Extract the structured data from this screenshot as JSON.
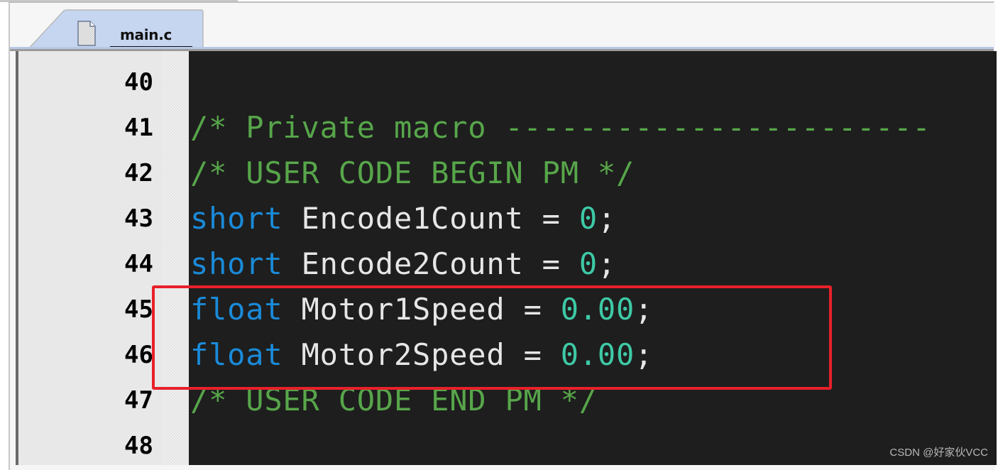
{
  "editor": {
    "tab": {
      "filename": "main.c",
      "icon": "document-icon"
    },
    "lines": [
      {
        "number": "40",
        "tokens": []
      },
      {
        "number": "41",
        "tokens": [
          {
            "type": "comment",
            "text": "/* Private macro -----------------------"
          }
        ]
      },
      {
        "number": "42",
        "tokens": [
          {
            "type": "comment",
            "text": "/* USER CODE BEGIN PM */"
          }
        ]
      },
      {
        "number": "43",
        "tokens": [
          {
            "type": "keyword",
            "text": "short"
          },
          {
            "type": "ident",
            "text": " Encode1Count "
          },
          {
            "type": "op",
            "text": "= "
          },
          {
            "type": "number",
            "text": "0"
          },
          {
            "type": "op",
            "text": ";"
          }
        ]
      },
      {
        "number": "44",
        "tokens": [
          {
            "type": "keyword",
            "text": "short"
          },
          {
            "type": "ident",
            "text": " Encode2Count "
          },
          {
            "type": "op",
            "text": "= "
          },
          {
            "type": "number",
            "text": "0"
          },
          {
            "type": "op",
            "text": ";"
          }
        ]
      },
      {
        "number": "45",
        "tokens": [
          {
            "type": "keyword",
            "text": "float"
          },
          {
            "type": "ident",
            "text": " Motor1Speed "
          },
          {
            "type": "op",
            "text": "= "
          },
          {
            "type": "number",
            "text": "0.00"
          },
          {
            "type": "op",
            "text": ";"
          }
        ]
      },
      {
        "number": "46",
        "tokens": [
          {
            "type": "keyword",
            "text": "float"
          },
          {
            "type": "ident",
            "text": " Motor2Speed "
          },
          {
            "type": "op",
            "text": "= "
          },
          {
            "type": "number",
            "text": "0.00"
          },
          {
            "type": "op",
            "text": ";"
          }
        ]
      },
      {
        "number": "47",
        "tokens": [
          {
            "type": "comment",
            "text": "/* USER CODE END PM */"
          }
        ]
      },
      {
        "number": "48",
        "tokens": []
      }
    ],
    "highlight": {
      "lines": [
        "45",
        "46"
      ],
      "color": "#e8202a"
    },
    "colors": {
      "background": "#1e1e1e",
      "comment": "#57a64a",
      "keyword": "#1a8ad8",
      "number": "#3ec9a6",
      "identifier": "#e6e6e6"
    }
  },
  "watermark": "CSDN @好家伙VCC"
}
